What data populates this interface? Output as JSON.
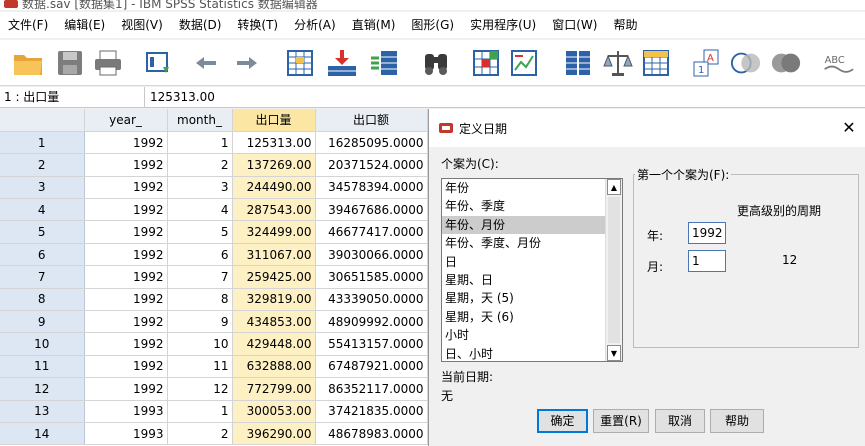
{
  "window": {
    "title": "数据.sav [数据集1] - IBM SPSS Statistics 数据编辑器"
  },
  "menu": [
    {
      "label": "文件(F)"
    },
    {
      "label": "编辑(E)"
    },
    {
      "label": "视图(V)"
    },
    {
      "label": "数据(D)"
    },
    {
      "label": "转换(T)"
    },
    {
      "label": "分析(A)"
    },
    {
      "label": "直销(M)"
    },
    {
      "label": "图形(G)"
    },
    {
      "label": "实用程序(U)"
    },
    {
      "label": "窗口(W)"
    },
    {
      "label": "帮助"
    }
  ],
  "toolbar": {
    "icons": [
      "open-folder-icon",
      "save-icon",
      "print-icon",
      "dialog-recall-icon",
      "undo-icon",
      "redo-icon",
      "goto-case-icon",
      "goto-variable-icon",
      "variables-icon",
      "find-icon",
      "insert-cases-icon",
      "insert-variable-icon",
      "split-file-icon",
      "weight-cases-icon",
      "select-cases-icon",
      "value-labels-icon",
      "use-sets-icon",
      "show-all-variables-icon",
      "spell-check-icon"
    ],
    "spell_label": "ABC"
  },
  "cellbar": {
    "reference": "1 : 出口量",
    "value": "125313.00"
  },
  "grid": {
    "columns": [
      "year_",
      "month_",
      "出口量",
      "出口额"
    ],
    "rows": [
      {
        "n": "1",
        "year": "1992",
        "month": "1",
        "qty": "125313.00",
        "amount": "16285095.0000"
      },
      {
        "n": "2",
        "year": "1992",
        "month": "2",
        "qty": "137269.00",
        "amount": "20371524.0000"
      },
      {
        "n": "3",
        "year": "1992",
        "month": "3",
        "qty": "244490.00",
        "amount": "34578394.0000"
      },
      {
        "n": "4",
        "year": "1992",
        "month": "4",
        "qty": "287543.00",
        "amount": "39467686.0000"
      },
      {
        "n": "5",
        "year": "1992",
        "month": "5",
        "qty": "324499.00",
        "amount": "46677417.0000"
      },
      {
        "n": "6",
        "year": "1992",
        "month": "6",
        "qty": "311067.00",
        "amount": "39030066.0000"
      },
      {
        "n": "7",
        "year": "1992",
        "month": "7",
        "qty": "259425.00",
        "amount": "30651585.0000"
      },
      {
        "n": "8",
        "year": "1992",
        "month": "8",
        "qty": "329819.00",
        "amount": "43339050.0000"
      },
      {
        "n": "9",
        "year": "1992",
        "month": "9",
        "qty": "434853.00",
        "amount": "48909992.0000"
      },
      {
        "n": "10",
        "year": "1992",
        "month": "10",
        "qty": "429448.00",
        "amount": "55413157.0000"
      },
      {
        "n": "11",
        "year": "1992",
        "month": "11",
        "qty": "632888.00",
        "amount": "67487921.0000"
      },
      {
        "n": "12",
        "year": "1992",
        "month": "12",
        "qty": "772799.00",
        "amount": "86352117.0000"
      },
      {
        "n": "13",
        "year": "1993",
        "month": "1",
        "qty": "300053.00",
        "amount": "37421835.0000"
      },
      {
        "n": "14",
        "year": "1993",
        "month": "2",
        "qty": "396290.00",
        "amount": "48678983.0000"
      }
    ]
  },
  "dialog": {
    "title": "定义日期",
    "close": "✕",
    "cases_label": "个案为(C):",
    "list": [
      "年份",
      "年份、季度",
      "年份、月份",
      "年份、季度、月份",
      "日",
      "星期、日",
      "星期，天 (5)",
      "星期，天 (6)",
      "小时",
      "日、小时"
    ],
    "selected_index": 2,
    "current_date_label": "当前日期:",
    "current_date_value": "无",
    "first_case_label": "第一个个案为(F):",
    "highest_period_label": "更高级别的周期",
    "year_label": "年:",
    "year_value": "1992",
    "month_label": "月:",
    "month_value": "1",
    "month_period": "12",
    "buttons": {
      "ok": "确定",
      "reset": "重置(R)",
      "cancel": "取消",
      "help": "帮助"
    }
  }
}
